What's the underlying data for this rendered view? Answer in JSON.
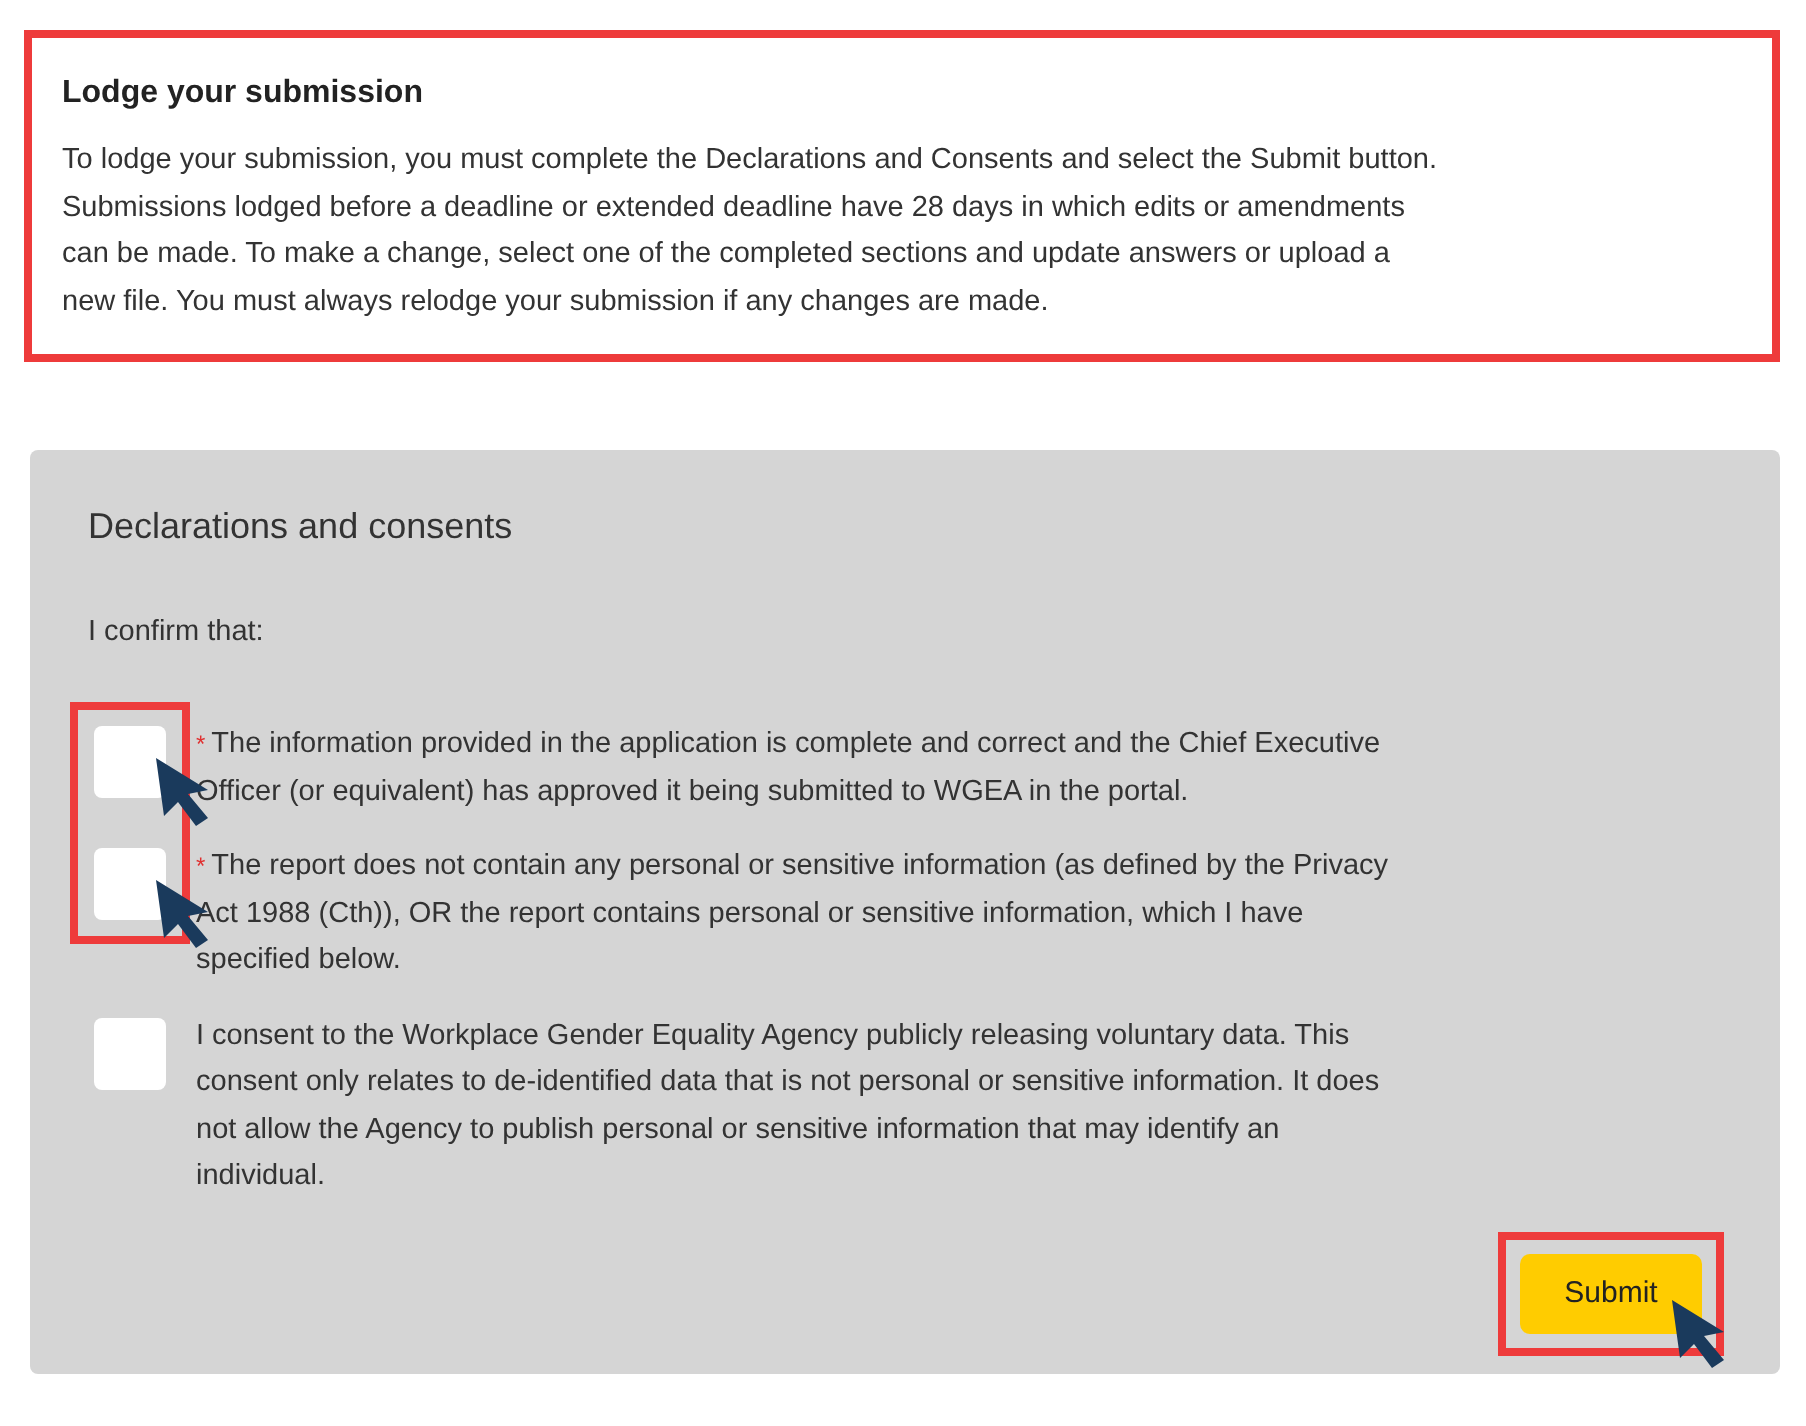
{
  "notice": {
    "title": "Lodge your submission",
    "text": "To lodge your submission, you must complete the Declarations and Consents and select the Submit button. Submissions lodged before a deadline or extended deadline have 28 days in which edits or amendments can be made. To make a change, select one of the completed sections and update answers or upload a new file. You must always relodge your submission if any changes are made."
  },
  "declarations": {
    "heading": "Declarations and consents",
    "intro": "I confirm that:",
    "items": [
      {
        "asterisk": "*",
        "text": "The information provided in the application is complete and correct and the Chief Executive Officer (or equivalent) has approved it being submitted to WGEA in the portal.",
        "checked": false,
        "highlighted": true
      },
      {
        "asterisk": "*",
        "text": "The report does not contain any personal or sensitive information (as defined by the Privacy Act 1988 (Cth)), OR the report contains personal or sensitive information, which I have specified below.",
        "checked": false,
        "highlighted": true
      },
      {
        "text": "I consent to the Workplace Gender Equality Agency publicly releasing voluntary data. This consent only relates to de-identified data that is not personal or sensitive information. It does not allow the Agency to publish personal or sensitive information that may identify an individual.",
        "checked": false,
        "highlighted": false
      }
    ],
    "submit": {
      "label": "Submit",
      "highlighted": true
    }
  }
}
